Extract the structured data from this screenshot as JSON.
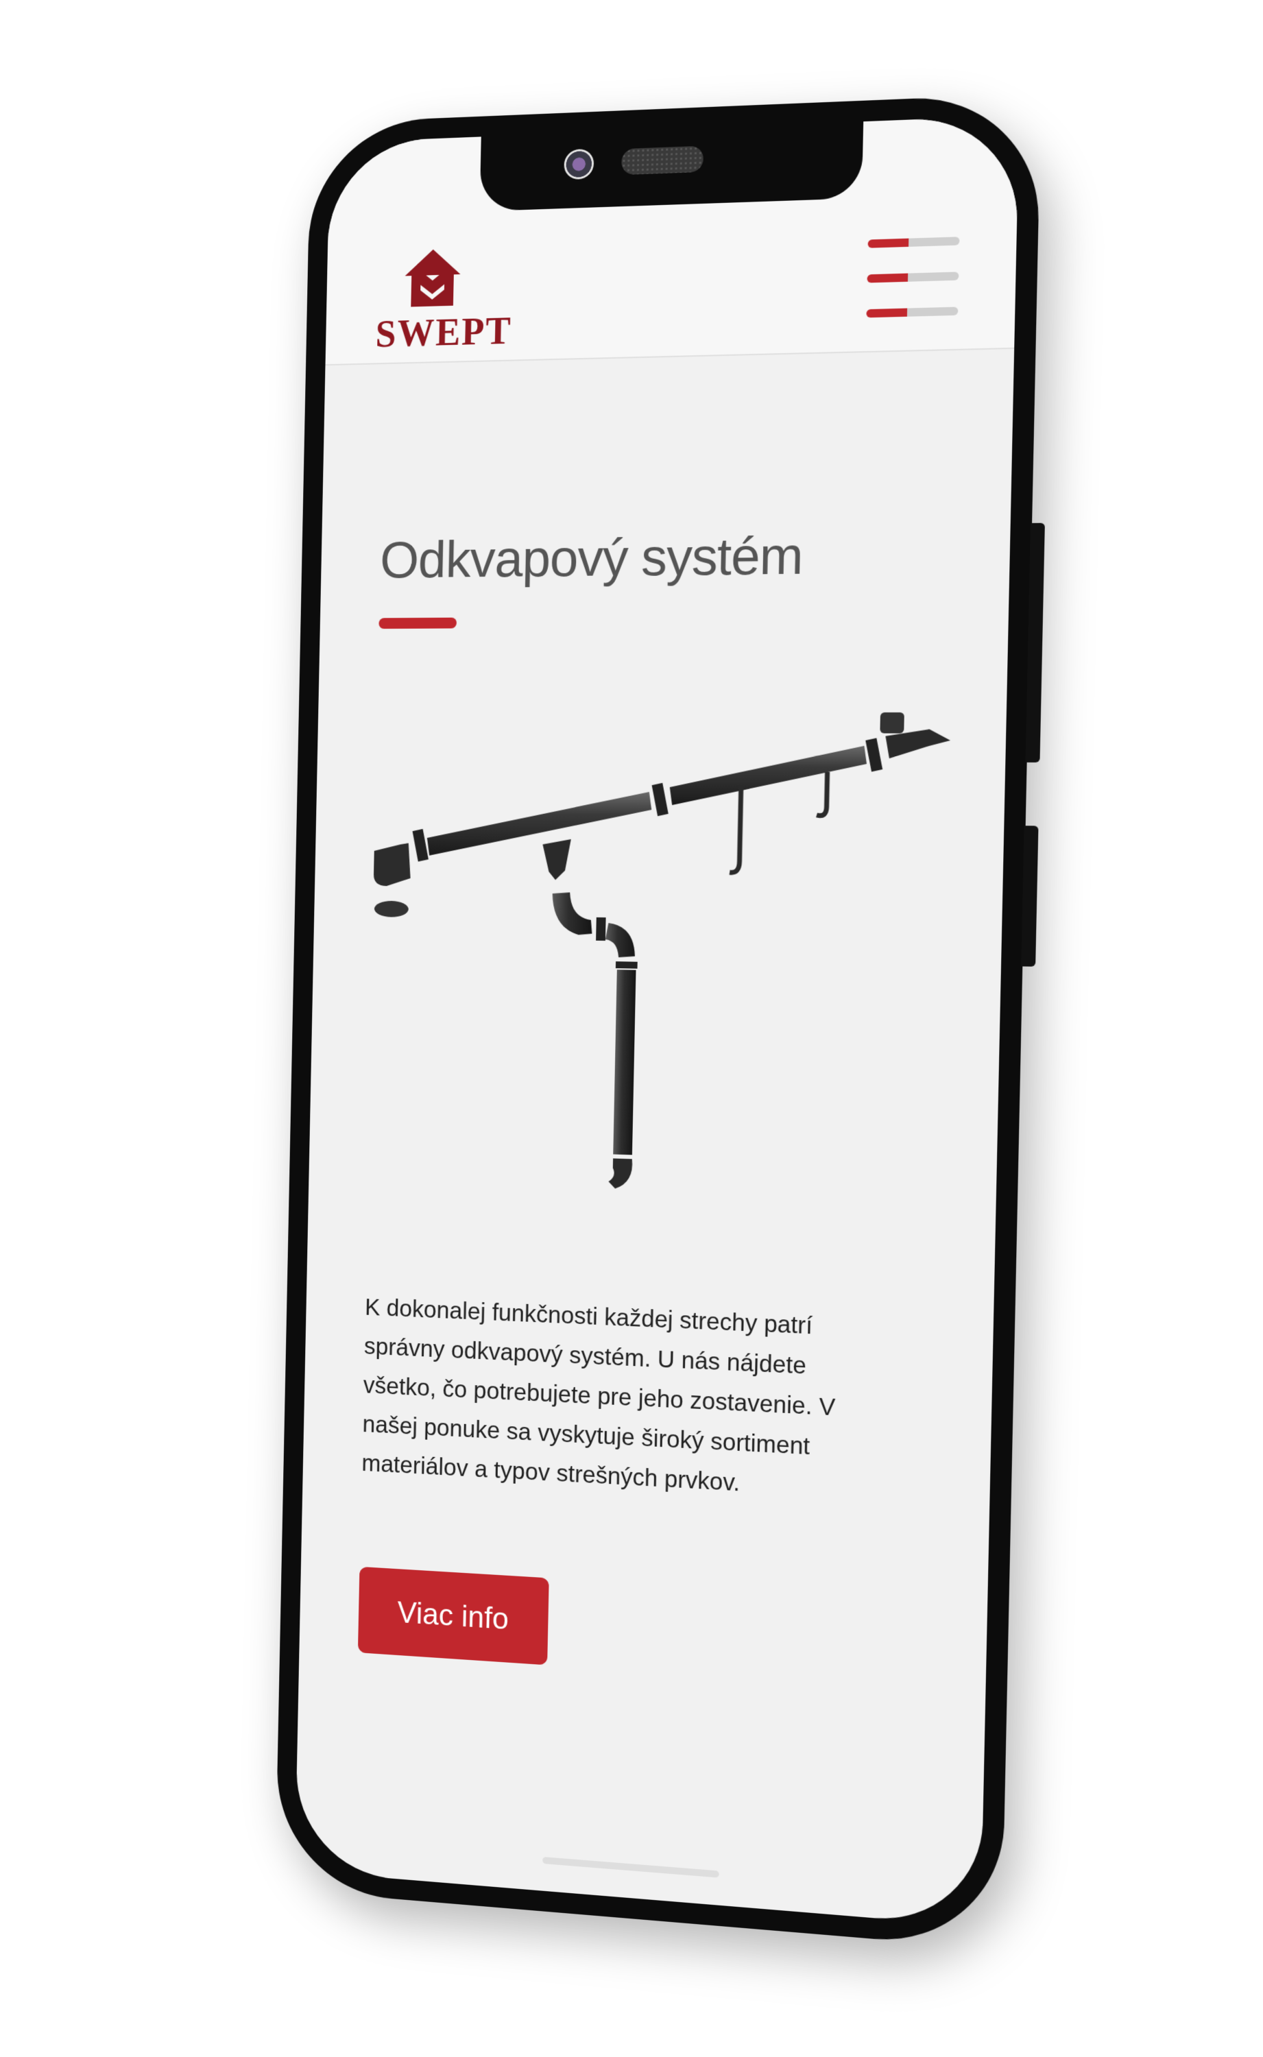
{
  "header": {
    "logo_text": "SWEPT",
    "menu_icon": "hamburger-menu-icon"
  },
  "main": {
    "title": "Odkvapový systém",
    "image_icon": "gutter-system-illustration",
    "description": "K dokonalej funkčnosti každej strechy patrí správny odkvapový systém. U nás nájdete všetko, čo potrebujete pre jeho zostavenie. V našej ponuke sa vyskytuje široký sortiment materiálov a typov strešných prvkov.",
    "cta_label": "Viac info"
  },
  "colors": {
    "accent": "#c1272d",
    "brand": "#8f1820",
    "title_text": "#555555",
    "body_text": "#222222",
    "screen_background": "#f1f1f1"
  }
}
